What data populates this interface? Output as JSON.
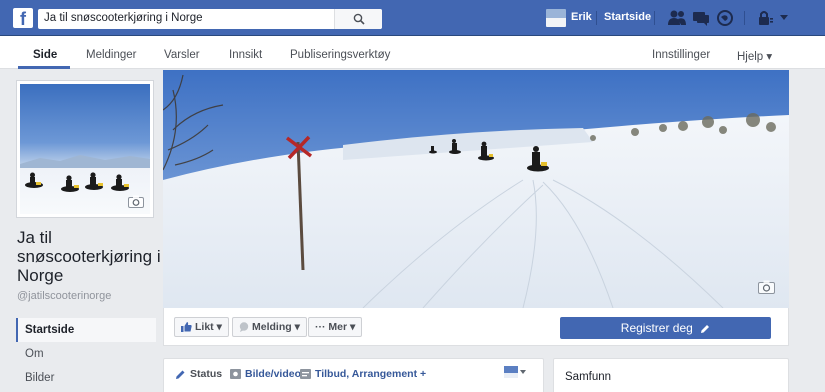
{
  "topbar": {
    "logo": "f",
    "search_value": "Ja til snøscooterkjøring i Norge",
    "user_name": "Erik",
    "home_label": "Startside"
  },
  "tabs": [
    {
      "label": "Side"
    },
    {
      "label": "Meldinger"
    },
    {
      "label": "Varsler"
    },
    {
      "label": "Innsikt"
    },
    {
      "label": "Publiseringsverktøy"
    }
  ],
  "tab_right": {
    "settings": "Innstillinger",
    "help": "Hjelp ▾"
  },
  "page": {
    "name": "Ja til snøscooterkjøring i Norge",
    "handle": "@jatilscooterinorge"
  },
  "side_nav": [
    {
      "label": "Startside"
    },
    {
      "label": "Om"
    },
    {
      "label": "Bilder"
    }
  ],
  "actions": {
    "like": "Likt ▾",
    "message": "Melding ▾",
    "more": "··· Mer ▾",
    "register": "Registrer deg"
  },
  "composer": {
    "status": "Status",
    "photo": "Bilde/video",
    "offer": "Tilbud, Arrangement +"
  },
  "community": {
    "title": "Samfunn"
  },
  "icons": [
    "facebook-logo",
    "search-icon",
    "friends-icon",
    "messages-icon",
    "globe-icon",
    "lock-icon",
    "camera-icon",
    "thumbs-up-icon",
    "chat-icon",
    "pencil-icon",
    "photo-icon",
    "offer-icon"
  ],
  "colors": {
    "brand": "#4267b2",
    "link": "#365899",
    "background": "#e9ebee"
  }
}
